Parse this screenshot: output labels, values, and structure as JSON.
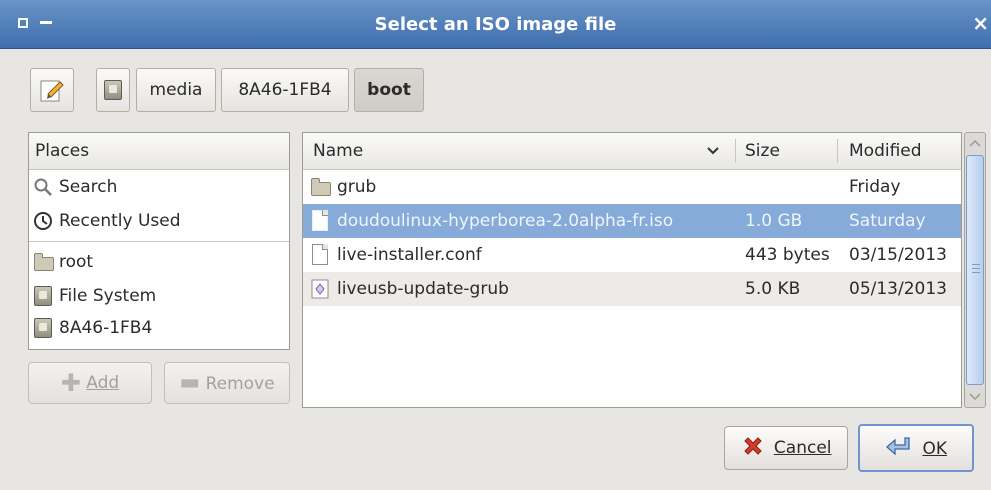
{
  "window": {
    "title": "Select an ISO image file",
    "close": "×"
  },
  "pathbar": {
    "buttons": [
      "media",
      "8A46-1FB4",
      "boot"
    ],
    "active": "boot"
  },
  "places": {
    "header": "Places",
    "items": [
      {
        "label": "Search",
        "icon": "search-icon"
      },
      {
        "label": "Recently Used",
        "icon": "recent-icon"
      },
      {
        "label": "root",
        "icon": "folder-icon"
      },
      {
        "label": "File System",
        "icon": "drive-icon"
      },
      {
        "label": "8A46-1FB4",
        "icon": "drive-icon"
      }
    ],
    "add": "Add",
    "remove": "Remove"
  },
  "files": {
    "columns": {
      "name": "Name",
      "size": "Size",
      "modified": "Modified"
    },
    "rows": [
      {
        "name": "grub",
        "size": "",
        "modified": "Friday",
        "type": "folder"
      },
      {
        "name": "doudoulinux-hyperborea-2.0alpha-fr.iso",
        "size": "1.0 GB",
        "modified": "Saturday",
        "type": "file",
        "selected": true
      },
      {
        "name": "live-installer.conf",
        "size": "443 bytes",
        "modified": "03/15/2013",
        "type": "file"
      },
      {
        "name": "liveusb-update-grub",
        "size": "5.0 KB",
        "modified": "05/13/2013",
        "type": "script"
      }
    ]
  },
  "buttons": {
    "cancel": "Cancel",
    "ok": "OK"
  },
  "colors": {
    "titlebar": "#4f7fbd",
    "selection": "#86abd9"
  }
}
